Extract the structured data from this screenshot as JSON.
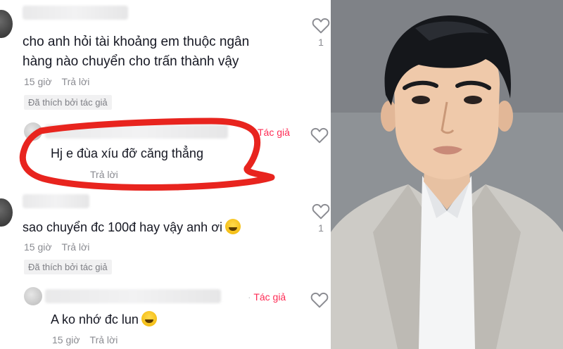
{
  "comments": [
    {
      "text_line1": "cho anh hỏi tài khoảng em thuộc ngân",
      "text_line2": "hàng nào chuyển cho trấn thành vậy",
      "time": "15 giờ",
      "reply": "Trả lời",
      "liked_by_author": "Đã thích bởi tác giả",
      "like_count": "1"
    },
    {
      "author_tag": "Tác giả",
      "text": "Hj e đùa xíu đỡ căng thẳng",
      "reply": "Trả lời"
    },
    {
      "text": "sao chuyển đc 100đ hay vậy anh ơi",
      "time": "15 giờ",
      "reply": "Trả lời",
      "liked_by_author": "Đã thích bởi tác giả",
      "like_count": "1"
    },
    {
      "author_tag": "Tác giả",
      "text": "A ko nhớ đc lun",
      "time": "15 giờ",
      "reply": "Trả lời"
    }
  ],
  "icons": {
    "heart": "heart-outline-icon",
    "emoji_laugh": "laughing-emoji-icon",
    "emoji_grin": "grinning-emoji-icon"
  },
  "colors": {
    "highlight_circle": "#e8241e",
    "author_tag": "#fe2c55",
    "meta_gray": "#8a8b91"
  }
}
